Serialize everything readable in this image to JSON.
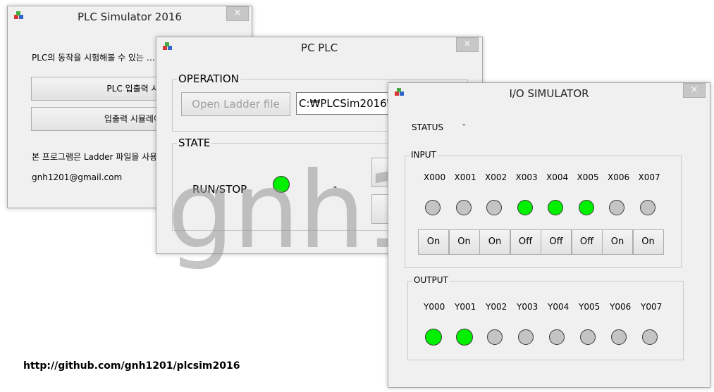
{
  "win1": {
    "title": "PLC Simulator 2016",
    "close": "×",
    "desc": "PLC의 동작을 시험해볼 수 있는 …",
    "btn_io": "PLC 입출력 시작",
    "btn_sim": "입출력 시뮬레이터",
    "info": "본 프로그램은 Ladder 파일을 사용",
    "email": "gnh1201@gmail.com"
  },
  "win2": {
    "title": "PC PLC",
    "close": "×",
    "operation_legend": "OPERATION",
    "open_button": "Open Ladder file",
    "path_value": "C:₩PLCSim2016₩",
    "state_legend": "STATE",
    "runstop_label": "RUN/STOP",
    "runstop_value": "-"
  },
  "win3": {
    "title": "I/O SIMULATOR",
    "close": "×",
    "status_label": "STATUS",
    "status_value": "-",
    "input_legend": "INPUT",
    "output_legend": "OUTPUT",
    "inputs": [
      {
        "label": "X000",
        "on": false,
        "btn": "On"
      },
      {
        "label": "X001",
        "on": false,
        "btn": "On"
      },
      {
        "label": "X002",
        "on": false,
        "btn": "On"
      },
      {
        "label": "X003",
        "on": true,
        "btn": "Off"
      },
      {
        "label": "X004",
        "on": true,
        "btn": "Off"
      },
      {
        "label": "X005",
        "on": true,
        "btn": "Off"
      },
      {
        "label": "X006",
        "on": false,
        "btn": "On"
      },
      {
        "label": "X007",
        "on": false,
        "btn": "On"
      }
    ],
    "outputs": [
      {
        "label": "Y000",
        "on": true
      },
      {
        "label": "Y001",
        "on": true
      },
      {
        "label": "Y002",
        "on": false
      },
      {
        "label": "Y003",
        "on": false
      },
      {
        "label": "Y004",
        "on": false
      },
      {
        "label": "Y005",
        "on": false
      },
      {
        "label": "Y006",
        "on": false
      },
      {
        "label": "Y007",
        "on": false
      }
    ]
  },
  "watermark": "gnh1201",
  "url": "http://github.com/gnh1201/plcsim2016",
  "colors": {
    "led_on": "#00f000",
    "led_off": "#c4c4c4",
    "window_bg": "#f0f0f0"
  }
}
